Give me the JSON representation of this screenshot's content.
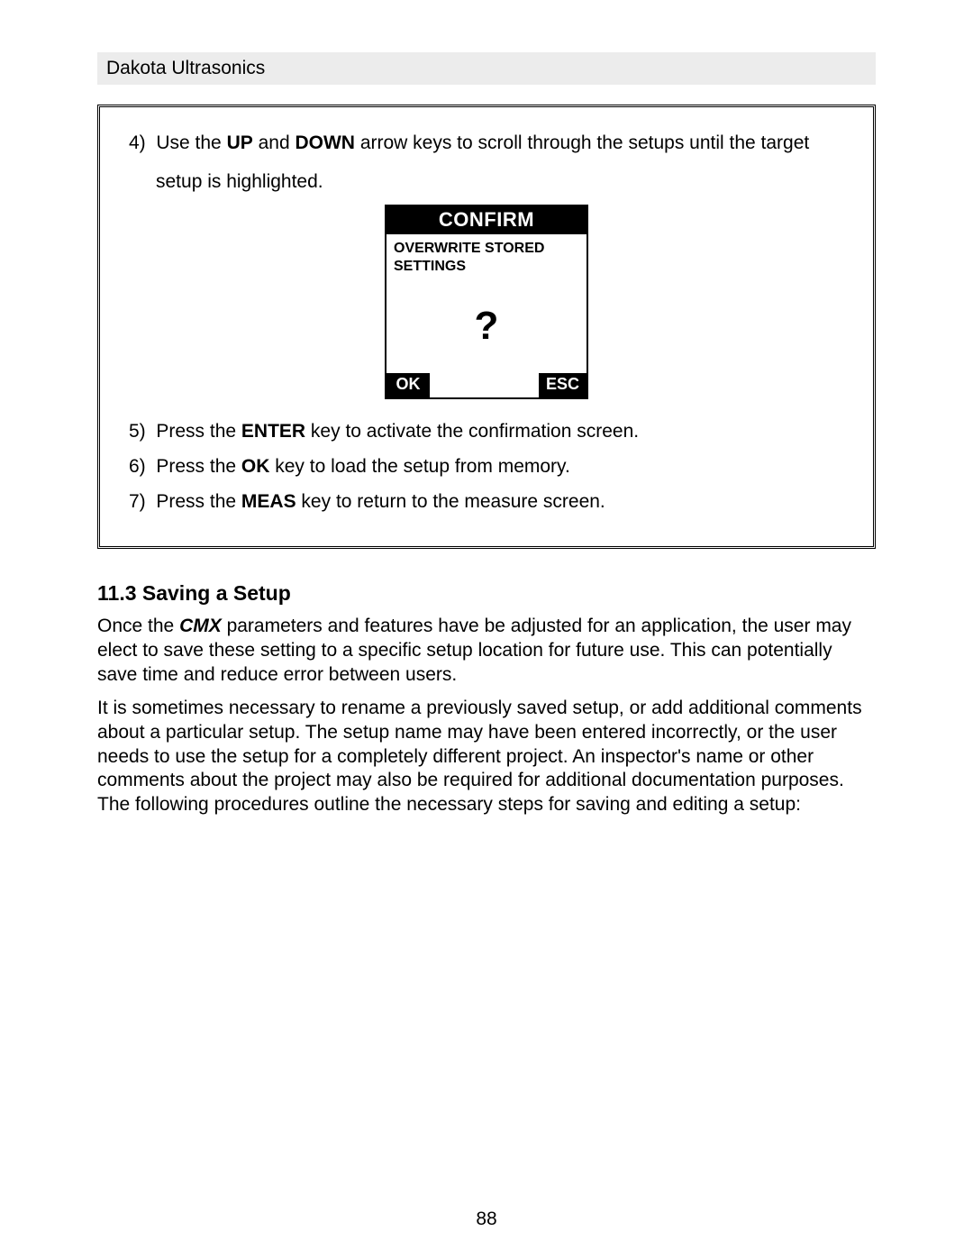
{
  "header": {
    "company": "Dakota Ultrasonics"
  },
  "steps": {
    "s4": {
      "num": "4)",
      "part1": "Use the ",
      "kw1": "UP",
      "mid1": " and ",
      "kw2": "DOWN",
      "part2": " arrow keys to scroll through the setups until the target setup is highlighted."
    },
    "s5": {
      "num": "5)",
      "part1": "Press the ",
      "kw": "ENTER",
      "part2": " key to activate the confirmation screen."
    },
    "s6": {
      "num": "6)",
      "part1": "Press the ",
      "kw": "OK",
      "part2": " key to load the setup from memory."
    },
    "s7": {
      "num": "7)",
      "part1": "Press the ",
      "kw": "MEAS",
      "part2": " key to return to the measure screen."
    }
  },
  "screen": {
    "title": "CONFIRM",
    "message": "OVERWRITE STORED SETTINGS",
    "icon": "?",
    "ok": "OK",
    "esc": "ESC"
  },
  "section": {
    "heading": "11.3 Saving a Setup"
  },
  "para1": {
    "t1": "Once the ",
    "device": "CMX",
    "t2": " parameters and features have be adjusted for an application, the user may elect to save these setting to a specific setup location for future use.  This can potentially save time and reduce error between users."
  },
  "para2": {
    "t": "It is sometimes necessary to rename a previously saved setup, or add additional comments about a particular setup.  The setup name may have been entered incorrectly, or the user needs to use the setup for a completely different project.  An inspector's name or other comments about the project may also be required for additional documentation purposes.  The following procedures outline the necessary steps for saving and editing a setup:"
  },
  "pageNumber": "88"
}
